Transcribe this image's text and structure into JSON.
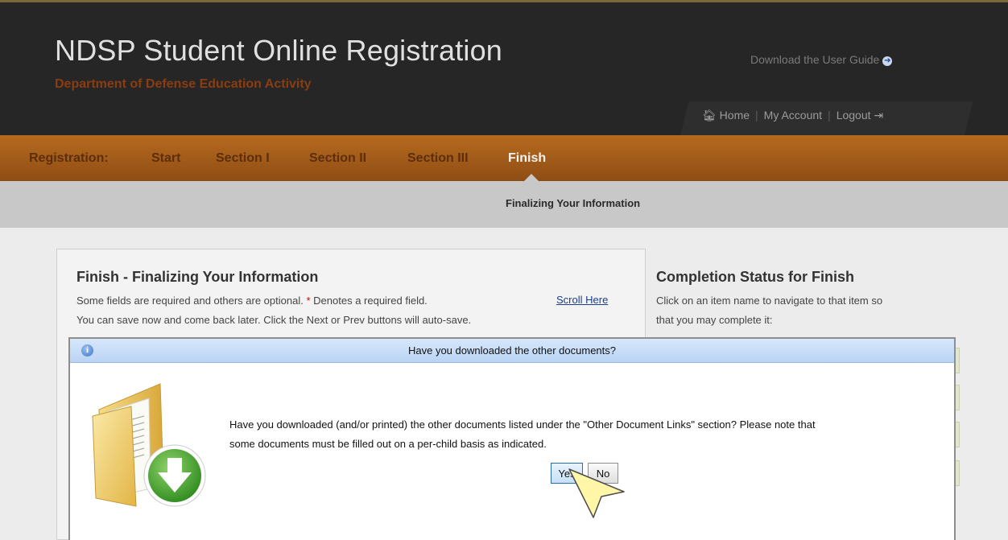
{
  "header": {
    "title": "NDSP Student Online Registration",
    "subtitle": "Department of Defense Education Activity",
    "user_guide_label": "Download the User Guide",
    "home_label": "Home",
    "my_account_label": "My Account",
    "logout_label": "Logout"
  },
  "nav": {
    "prefix": "Registration:",
    "steps": [
      "Start",
      "Section I",
      "Section II",
      "Section III",
      "Finish"
    ],
    "active_step": "Finish"
  },
  "subheader": {
    "title": "Finalizing Your Information"
  },
  "main": {
    "title": "Finish - Finalizing Your Information",
    "line1_before": "Some fields are required and others are optional.",
    "required_marker": "*",
    "line1_after": "Denotes a required field.",
    "scroll_link": "Scroll Here",
    "line2": "You can save now and come back later. Click the Next or Prev buttons will auto-save."
  },
  "status": {
    "title": "Completion Status for Finish",
    "line1": "Click on an item name to navigate to that item so",
    "line2": "that you may complete it:"
  },
  "dialog": {
    "title": "Have you downloaded the other documents?",
    "message_line1": "Have you downloaded (and/or printed) the other documents listed under the \"Other Document Links\" section? Please note that",
    "message_line2": "some documents must be filled out on a per-child basis as indicated.",
    "yes_label": "Yes",
    "no_label": "No"
  },
  "colors": {
    "header_bg": "#262626",
    "nav_bg": "#a65e1a",
    "subtitle": "#8a3d10",
    "dialog_bar": "#c7ddf7",
    "link": "#1a3f8f"
  },
  "icons": {
    "user_guide": "circle-arrow-icon",
    "home": "home-icon",
    "logout": "logout-icon",
    "dialog_info": "info-icon",
    "dialog_graphic": "folder-download-icon",
    "cursor": "pointer-cursor-icon"
  }
}
